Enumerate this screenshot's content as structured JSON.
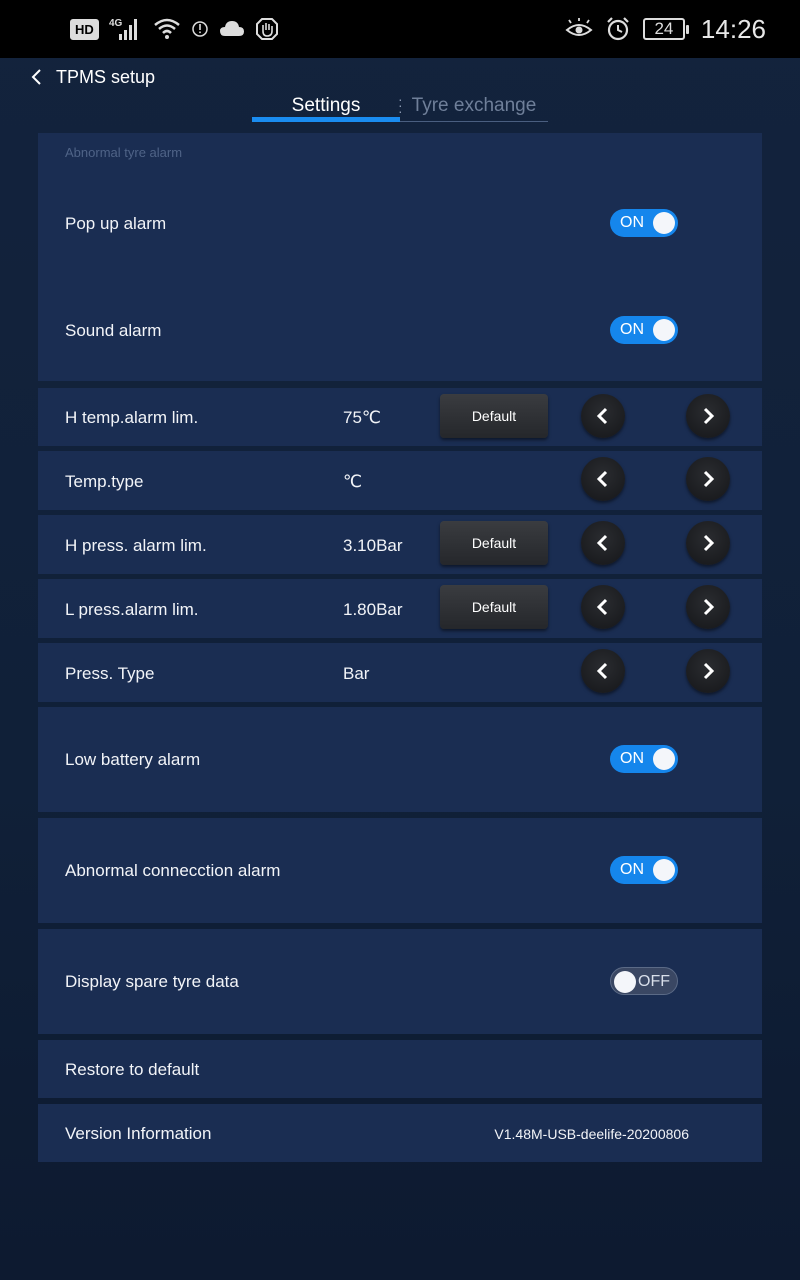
{
  "status_bar": {
    "hd": "HD",
    "network": "4G",
    "battery": "24",
    "time": "14:26",
    "icons": [
      "signal-icon",
      "wifi-icon",
      "alert-icon",
      "cloud-icon",
      "hand-icon",
      "eye-icon",
      "alarm-clock-icon",
      "battery-icon"
    ]
  },
  "header": {
    "title": "TPMS setup",
    "back_icon": "chevron-left-icon"
  },
  "tabs": [
    {
      "label": "Settings",
      "active": true
    },
    {
      "label": "Tyre exchange",
      "active": false
    }
  ],
  "alarm_section": {
    "caption": "Abnormal tyre alarm",
    "popup": {
      "label": "Pop up alarm",
      "state": "ON"
    },
    "sound": {
      "label": "Sound alarm",
      "state": "ON"
    }
  },
  "h_temp": {
    "label": "H temp.alarm lim.",
    "value": "75℃",
    "default_label": "Default"
  },
  "temp_type": {
    "label": "Temp.type",
    "value": "℃"
  },
  "h_press": {
    "label": "H press. alarm lim.",
    "value": "3.10Bar",
    "default_label": "Default"
  },
  "l_press": {
    "label": "L press.alarm lim.",
    "value": "1.80Bar",
    "default_label": "Default"
  },
  "press_type": {
    "label": "Press. Type",
    "value": "Bar"
  },
  "low_battery": {
    "label": "Low battery alarm",
    "state": "ON"
  },
  "abnormal_connection": {
    "label": "Abnormal connecction alarm",
    "state": "ON"
  },
  "spare_tyre": {
    "label": "Display spare tyre data",
    "state": "OFF"
  },
  "restore": {
    "label": "Restore to default"
  },
  "version": {
    "label": "Version Information",
    "value": "V1.48M-USB-deelife-20200806"
  },
  "colors": {
    "accent": "#1586ec",
    "panel": "#1a2d52",
    "background": "#13233d",
    "button": "#2a2c30"
  }
}
